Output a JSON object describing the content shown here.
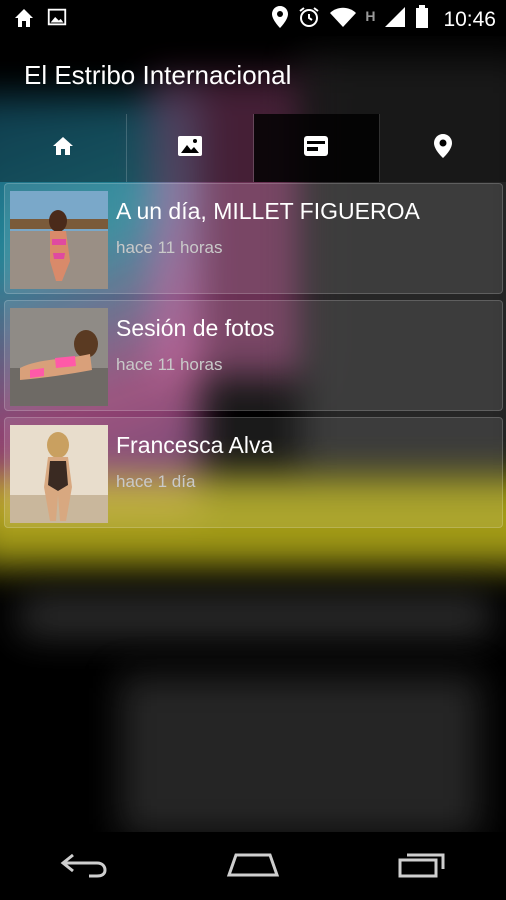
{
  "status_bar": {
    "time": "10:46",
    "left_icons": [
      "home-icon",
      "image-icon"
    ],
    "right_icons": [
      "location-icon",
      "alarm-icon",
      "wifi-icon",
      "signal-icon",
      "battery-icon"
    ],
    "network_label": "H"
  },
  "app": {
    "title": "El Estribo Internacional"
  },
  "tabs": [
    {
      "icon": "home-icon",
      "active": false
    },
    {
      "icon": "gallery-icon",
      "active": false
    },
    {
      "icon": "article-icon",
      "active": true
    },
    {
      "icon": "location-pin-icon",
      "active": false
    }
  ],
  "posts": [
    {
      "title": "A un día, MILLET FIGUEROA",
      "time": "hace 11 horas"
    },
    {
      "title": "Sesión de fotos",
      "time": "hace 11 horas"
    },
    {
      "title": "Francesca Alva",
      "time": "hace 1 día"
    }
  ],
  "colors": {
    "accent_yellow": "#d9cf1e",
    "accent_teal": "#2d9fb4",
    "accent_pink": "#c25a9a"
  },
  "nav_bar": [
    "back-icon",
    "home-icon",
    "recents-icon"
  ]
}
